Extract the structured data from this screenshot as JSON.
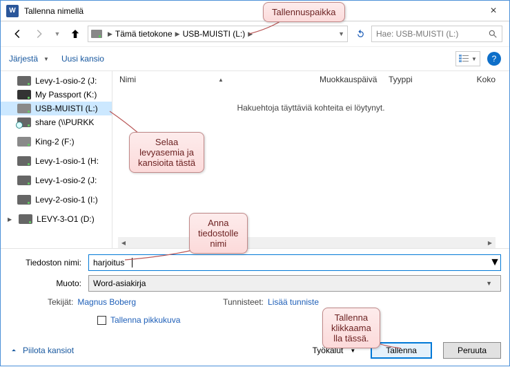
{
  "window": {
    "title": "Tallenna nimellä",
    "close": "×"
  },
  "nav": {
    "location1": "Tämä tietokone",
    "location2": "USB-MUISTI (L:)",
    "search_placeholder": "Hae: USB-MUISTI (L:)"
  },
  "toolbar": {
    "organize": "Järjestä",
    "newfolder": "Uusi kansio",
    "help": "?"
  },
  "sidebar": {
    "items": [
      {
        "label": "Levy-1-osio-2 (J:"
      },
      {
        "label": "My Passport (K:)"
      },
      {
        "label": "USB-MUISTI (L:)"
      },
      {
        "label": "share (\\\\PURKK"
      },
      {
        "label": "King-2 (F:)"
      },
      {
        "label": "Levy-1-osio-1 (H:"
      },
      {
        "label": "Levy-1-osio-2 (J:"
      },
      {
        "label": "Levy-2-osio-1 (I:)"
      },
      {
        "label": "LEVY-3-O1 (D:)"
      }
    ]
  },
  "columns": {
    "name": "Nimi",
    "date": "Muokkauspäivä",
    "type": "Tyyppi",
    "size": "Koko"
  },
  "list": {
    "empty": "Hakuehtoja täyttäviä kohteita ei löytynyt."
  },
  "form": {
    "filename_label": "Tiedoston nimi:",
    "filename_value": "harjoitus",
    "format_label": "Muoto:",
    "format_value": "Word-asiakirja",
    "authors_label": "Tekijät:",
    "authors_value": "Magnus Boberg",
    "tags_label": "Tunnisteet:",
    "tags_value": "Lisää tunniste",
    "thumb_label": "Tallenna pikkukuva"
  },
  "footer": {
    "hide": "Piilota kansiot",
    "tools": "Työkalut",
    "save": "Tallenna",
    "cancel": "Peruuta"
  },
  "callouts": {
    "c1": "Tallennuspaikka",
    "c2_l1": "Selaa",
    "c2_l2": "levyasemia ja",
    "c2_l3": "kansioita tästä",
    "c3_l1": "Anna",
    "c3_l2": "tiedostolle",
    "c3_l3": "nimi",
    "c4_l1": "Tallenna",
    "c4_l2": "klikkaama",
    "c4_l3": "lla tässä."
  }
}
